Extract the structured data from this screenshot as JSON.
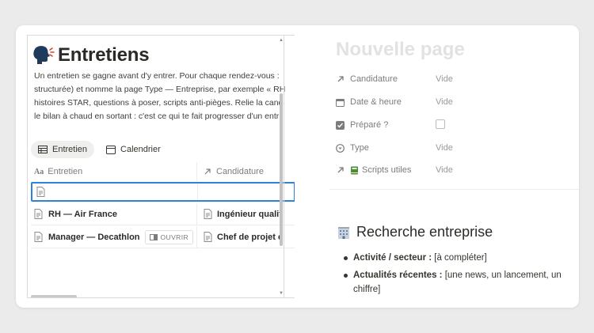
{
  "left": {
    "title": "Entretiens",
    "description_lines": [
      "Un entretien se gagne avant d'y entrer. Pour chaque rendez-vous :",
      "structurée) et nomme la page Type — Entreprise, par exemple « RH",
      "histoires STAR, questions à poser, scripts anti-pièges. Relie la candi",
      "le bilan à chaud en sortant : c'est ce qui te fait progresser d'un entr"
    ],
    "views": [
      {
        "label": "Entretien",
        "icon": "table-icon"
      },
      {
        "label": "Calendrier",
        "icon": "calendar-icon"
      }
    ],
    "columns": [
      {
        "label": "Entretien",
        "icon": "text-property-icon",
        "icon_text": "Aa"
      },
      {
        "label": "Candidature",
        "icon": "relation-arrow-icon"
      }
    ],
    "rows": [
      {
        "name": "RH — Air France",
        "candidature": "Ingénieur qualit"
      },
      {
        "name": "Manager — Decathlon",
        "candidature": "Chef de projet c",
        "open_label": "OUVRIR"
      }
    ]
  },
  "right": {
    "title": "Nouvelle page",
    "properties": [
      {
        "label": "Candidature",
        "value": "Vide",
        "icon": "relation-arrow-icon"
      },
      {
        "label": "Date & heure",
        "value": "Vide",
        "icon": "calendar-icon"
      },
      {
        "label": "Préparé ?",
        "value": "",
        "icon": "checkbox-icon"
      },
      {
        "label": "Type",
        "value": "Vide",
        "icon": "select-icon"
      },
      {
        "label": "Scripts utiles",
        "value": "Vide",
        "icon": "relation-arrow-icon"
      }
    ],
    "section_title": "Recherche entreprise",
    "bullets": [
      {
        "label": "Activité / secteur :",
        "text": " [à compléter]"
      },
      {
        "label": "Actualités récentes :",
        "text": " [une news, un lancement, un chiffre]"
      }
    ]
  },
  "colors": {
    "accent": "#2e83d8",
    "background": "#ebebeb",
    "text": "#37352f",
    "muted": "#9b9a97"
  }
}
